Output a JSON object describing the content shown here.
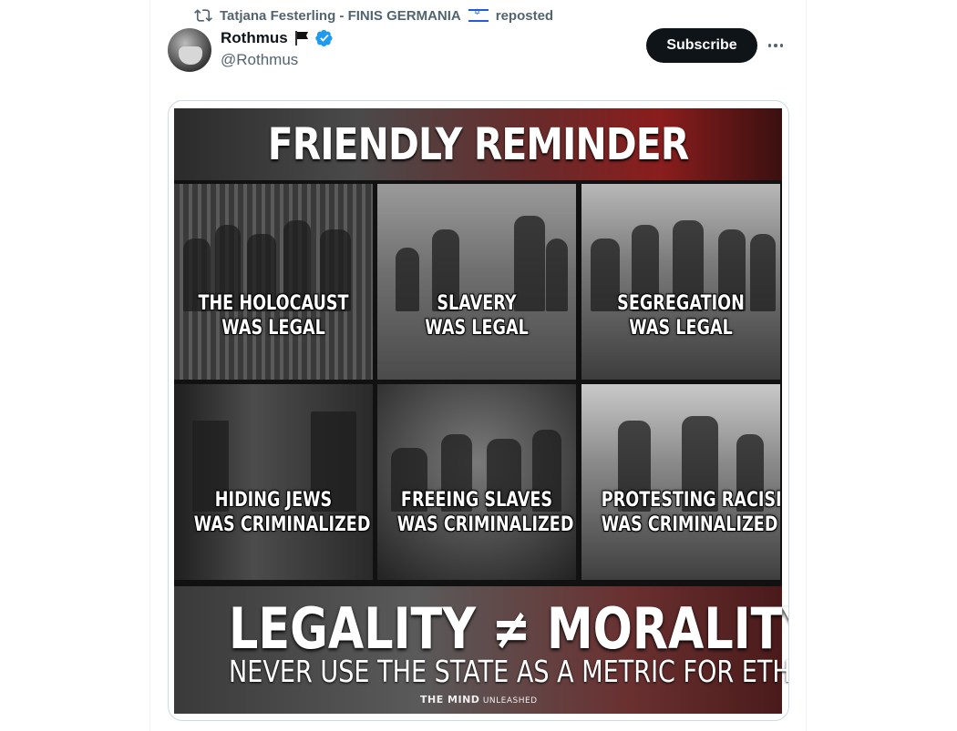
{
  "social_context": {
    "text": "Tatjana Festerling - FINIS GERMANIA",
    "suffix": "reposted",
    "icon": "repost-icon"
  },
  "author": {
    "name": "Rothmus",
    "handle": "@Rothmus",
    "verified": true
  },
  "actions": {
    "subscribe": "Subscribe",
    "more": "more-icon"
  },
  "meme": {
    "title": "FRIENDLY REMINDER",
    "tiles": [
      {
        "line1": "THE HOLOCAUST",
        "line2": "WAS LEGAL"
      },
      {
        "line1": "SLAVERY",
        "line2": "WAS LEGAL"
      },
      {
        "line1": "SEGREGATION",
        "line2": "WAS LEGAL"
      },
      {
        "line1": "HIDING JEWS",
        "line2": "WAS CRIMINALIZED"
      },
      {
        "line1": "FREEING SLAVES",
        "line2": "WAS CRIMINALIZED"
      },
      {
        "line1": "PROTESTING RACISM",
        "line2": "WAS CRIMINALIZED"
      }
    ],
    "headline": "LEGALITY ≠ MORALITY",
    "subline": "NEVER USE THE STATE AS A METRIC FOR ETHICS",
    "logo_main": "THE MIND",
    "logo_sub": "UNLEASHED"
  },
  "colors": {
    "accent": "#1d9bf0",
    "text": "#0f1419",
    "muted": "#536471",
    "button_bg": "#0f1419"
  }
}
